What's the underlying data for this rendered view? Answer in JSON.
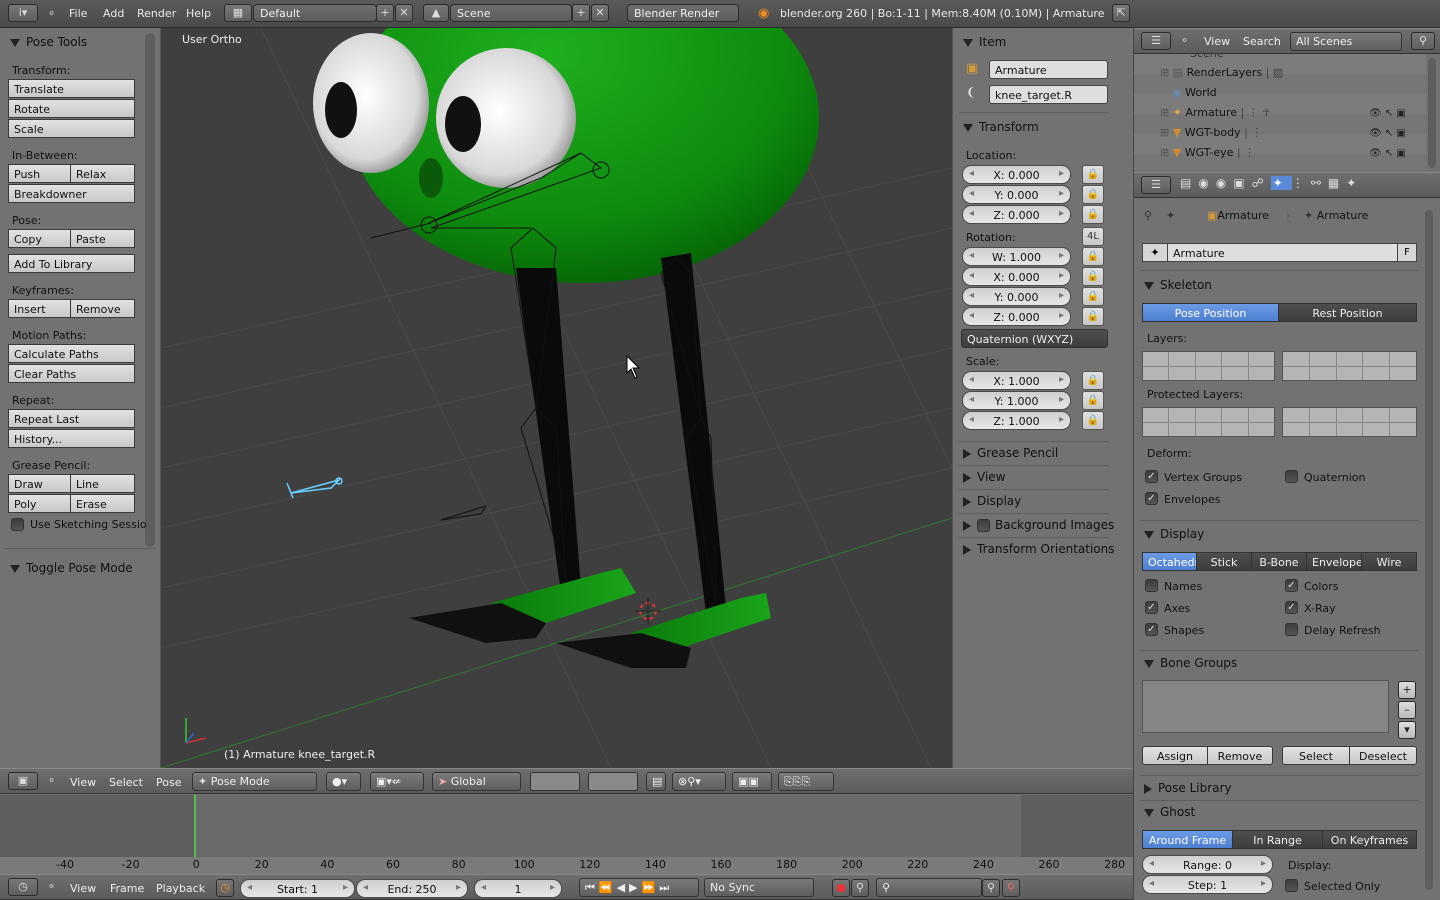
{
  "topbar": {
    "menus": [
      "File",
      "Add",
      "Render",
      "Help"
    ],
    "layout": "Default",
    "scene": "Scene",
    "engine": "Blender Render",
    "info": "blender.org 260 | Bo:1-11  | Mem:8.40M (0.10M) | Armature"
  },
  "tools": {
    "title": "Pose Tools",
    "transform_label": "Transform:",
    "translate": "Translate",
    "rotate": "Rotate",
    "scale": "Scale",
    "inbetween_label": "In-Between:",
    "push": "Push",
    "relax": "Relax",
    "breakdowner": "Breakdowner",
    "pose_label": "Pose:",
    "copy": "Copy",
    "paste": "Paste",
    "add_library": "Add To Library",
    "keyframes_label": "Keyframes:",
    "insert": "Insert",
    "remove": "Remove",
    "motion_label": "Motion Paths:",
    "calc_paths": "Calculate Paths",
    "clear_paths": "Clear Paths",
    "repeat_label": "Repeat:",
    "repeat_last": "Repeat Last",
    "history": "History...",
    "grease_label": "Grease Pencil:",
    "draw": "Draw",
    "line": "Line",
    "poly": "Poly",
    "erase": "Erase",
    "sketching": "Use Sketching Sessio",
    "toggle_pose": "Toggle Pose Mode"
  },
  "viewport": {
    "view_label": "User Ortho",
    "status": "(1) Armature knee_target.R"
  },
  "props_n": {
    "item_title": "Item",
    "object_name": "Armature",
    "bone_name": "knee_target.R",
    "transform_title": "Transform",
    "location_label": "Location:",
    "loc_x": "X: 0.000",
    "loc_y": "Y: 0.000",
    "loc_z": "Z: 0.000",
    "rotation_label": "Rotation:",
    "rot_4l": "4L",
    "rot_w": "W: 1.000",
    "rot_x": "X: 0.000",
    "rot_y": "Y: 0.000",
    "rot_z": "Z: 0.000",
    "rot_mode": "Quaternion (WXYZ)",
    "scale_label": "Scale:",
    "scale_x": "X: 1.000",
    "scale_y": "Y: 1.000",
    "scale_z": "Z: 1.000",
    "grease_pencil": "Grease Pencil",
    "view": "View",
    "display": "Display",
    "background_images": "Background Images",
    "transform_orient": "Transform Orientations"
  },
  "outliner": {
    "view": "View",
    "search": "Search",
    "scenes": "All Scenes",
    "scene_partial": "Scene",
    "rows": [
      "RenderLayers",
      "World",
      "Armature",
      "WGT-body",
      "WGT-eye"
    ]
  },
  "properties": {
    "crumb_object": "Armature",
    "crumb_data": "Armature",
    "data_name": "Armature",
    "fake_user": "F",
    "skeleton_title": "Skeleton",
    "pose_position": "Pose Position",
    "rest_position": "Rest Position",
    "layers_label": "Layers:",
    "protected_label": "Protected Layers:",
    "deform_label": "Deform:",
    "vertex_groups": "Vertex Groups",
    "quaternion": "Quaternion",
    "envelopes": "Envelopes",
    "display_title": "Display",
    "octahedral": "Octahedra",
    "stick": "Stick",
    "bbone": "B-Bone",
    "envelope": "Envelope",
    "wire": "Wire",
    "names": "Names",
    "colors": "Colors",
    "axes": "Axes",
    "xray": "X-Ray",
    "shapes": "Shapes",
    "delay_refresh": "Delay Refresh",
    "bone_groups_title": "Bone Groups",
    "assign": "Assign",
    "remove": "Remove",
    "select": "Select",
    "deselect": "Deselect",
    "pose_library": "Pose Library",
    "ghost_title": "Ghost",
    "around_frame": "Around Frame",
    "in_range": "In Range",
    "on_keyframes": "On Keyframes",
    "range": "Range: 0",
    "step": "Step: 1",
    "display_label": "Display:",
    "selected_only": "Selected Only"
  },
  "view3d_header": {
    "view": "View",
    "select": "Select",
    "pose": "Pose",
    "mode": "Pose Mode",
    "orientation": "Global"
  },
  "timeline": {
    "ticks": [
      "-40",
      "-20",
      "0",
      "20",
      "40",
      "60",
      "80",
      "100",
      "120",
      "140",
      "160",
      "180",
      "200",
      "220",
      "240",
      "260",
      "280"
    ],
    "view": "View",
    "frame": "Frame",
    "playback": "Playback",
    "start": "Start: 1",
    "end": "End: 250",
    "current": "1",
    "sync": "No Sync"
  }
}
